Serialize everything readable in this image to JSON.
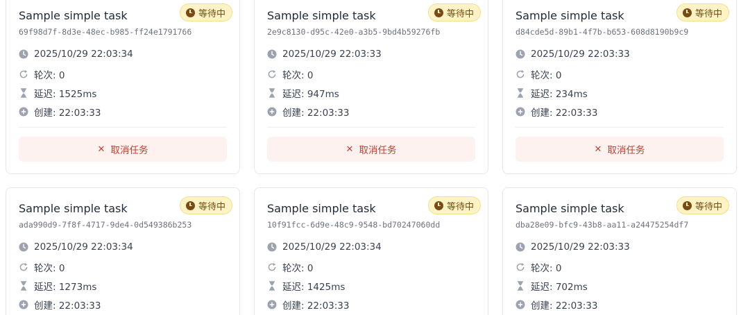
{
  "labels": {
    "round_prefix": "轮次: ",
    "delay_prefix": "延迟: ",
    "created_prefix": "创建: ",
    "cancel": "取消任务"
  },
  "colors": {
    "badge_bg": "#fdf3c4",
    "badge_text": "#7a4a12",
    "cancel_bg": "#fef2f1",
    "cancel_text": "#c2412f",
    "icon_gray": "#9ca3af"
  },
  "icons": {
    "status": "clock-icon",
    "time": "clock-icon",
    "round": "retry-icon",
    "delay": "hourglass-icon",
    "created": "plus-circle-icon",
    "cancel": "close-icon"
  },
  "tasks": [
    {
      "title": "Sample simple task",
      "id": "69f98d7f-8d3e-48ec-b985-ff24e1791766",
      "status": "等待中",
      "timestamp": "2025/10/29 22:03:34",
      "round": "轮次: 0",
      "delay": "延迟: 1525ms",
      "created": "创建: 22:03:33"
    },
    {
      "title": "Sample simple task",
      "id": "2e9c8130-d95c-42e0-a3b5-9bd4b59276fb",
      "status": "等待中",
      "timestamp": "2025/10/29 22:03:33",
      "round": "轮次: 0",
      "delay": "延迟: 947ms",
      "created": "创建: 22:03:33"
    },
    {
      "title": "Sample simple task",
      "id": "d84cde5d-89b1-4f7b-b653-608d8190b9c9",
      "status": "等待中",
      "timestamp": "2025/10/29 22:03:33",
      "round": "轮次: 0",
      "delay": "延迟: 234ms",
      "created": "创建: 22:03:33"
    },
    {
      "title": "Sample simple task",
      "id": "ada990d9-7f8f-4717-9de4-0d549386b253",
      "status": "等待中",
      "timestamp": "2025/10/29 22:03:34",
      "round": "轮次: 0",
      "delay": "延迟: 1273ms",
      "created": "创建: 22:03:33"
    },
    {
      "title": "Sample simple task",
      "id": "10f91fcc-6d9e-48c9-9548-bd70247060dd",
      "status": "等待中",
      "timestamp": "2025/10/29 22:03:34",
      "round": "轮次: 0",
      "delay": "延迟: 1425ms",
      "created": "创建: 22:03:33"
    },
    {
      "title": "Sample simple task",
      "id": "dba28e09-bfc9-43b8-aa11-a24475254df7",
      "status": "等待中",
      "timestamp": "2025/10/29 22:03:33",
      "round": "轮次: 0",
      "delay": "延迟: 702ms",
      "created": "创建: 22:03:33"
    }
  ],
  "cancel_label": "取消任务"
}
